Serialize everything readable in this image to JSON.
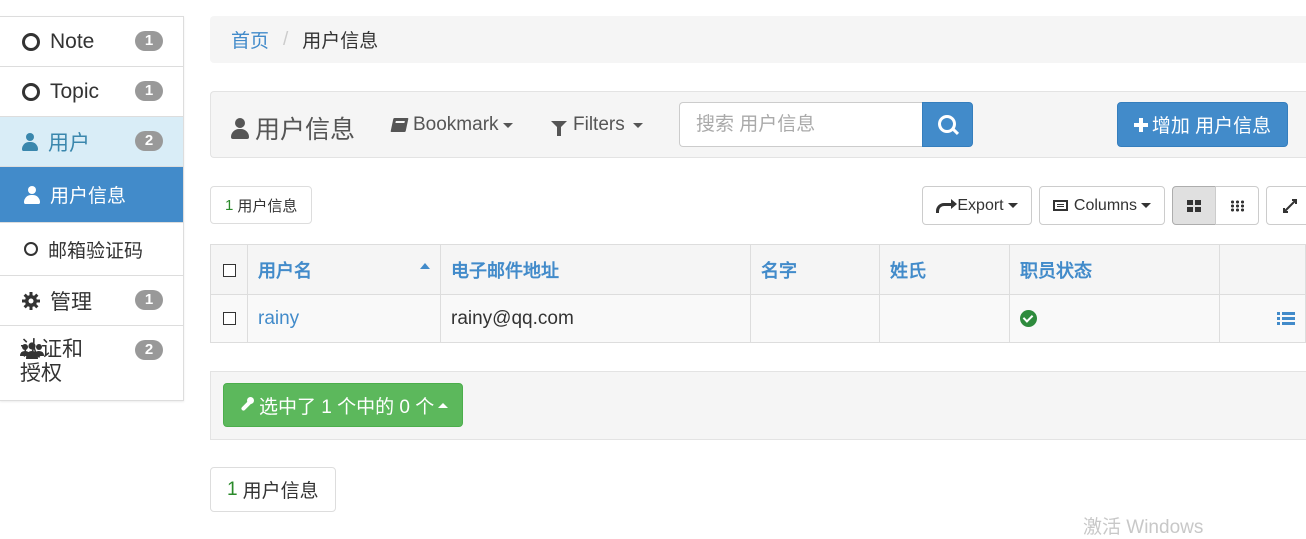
{
  "sidebar": {
    "items": [
      {
        "label": "Note",
        "badge": "1"
      },
      {
        "label": "Topic",
        "badge": "1"
      },
      {
        "label": "用户",
        "badge": "2"
      },
      {
        "label": "用户信息"
      },
      {
        "label": "邮箱验证码"
      },
      {
        "label": "管理",
        "badge": "1"
      },
      {
        "label": "认证和\n授权",
        "badge": "2"
      }
    ]
  },
  "breadcrumb": {
    "home": "首页",
    "separator": "/",
    "current": "用户信息"
  },
  "toolbar": {
    "title": "用户信息",
    "bookmark": "Bookmark",
    "filters": "Filters",
    "search_placeholder": "搜索 用户信息",
    "add_button": "增加 用户信息"
  },
  "summary": {
    "count": "1",
    "label": "用户信息"
  },
  "buttons": {
    "export": "Export",
    "columns": "Columns"
  },
  "table": {
    "headers": [
      "用户名",
      "电子邮件地址",
      "名字",
      "姓氏",
      "职员状态"
    ],
    "rows": [
      {
        "username": "rainy",
        "email": "rainy@qq.com",
        "first_name": "",
        "last_name": "",
        "is_staff": true
      }
    ]
  },
  "action_bar": {
    "selection": "选中了 1 个中的 0 个"
  },
  "footer": {
    "count": "1",
    "label": "用户信息"
  },
  "watermark": "激活 Windows",
  "colors": {
    "primary": "#428bca",
    "success": "#5cb85c",
    "active_parent_bg": "#d9edf7",
    "badge": "#999999"
  }
}
